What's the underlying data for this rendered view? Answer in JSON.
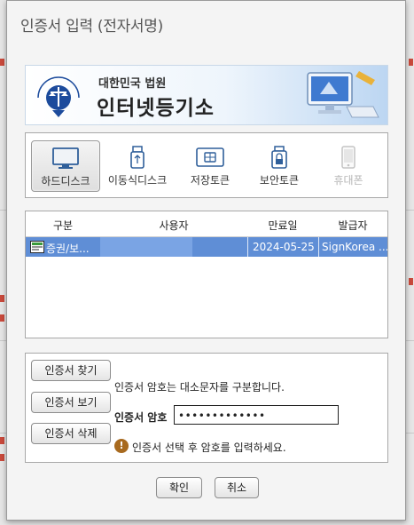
{
  "dialog": {
    "title": "인증서 입력 (전자서명)"
  },
  "banner": {
    "subtitle": "대한민국 법원",
    "main": "인터넷등기소"
  },
  "devices": [
    {
      "label": "하드디스크",
      "icon": "monitor-icon",
      "state": "selected"
    },
    {
      "label": "이동식디스크",
      "icon": "usb-icon",
      "state": "normal"
    },
    {
      "label": "저장토큰",
      "icon": "smartcard-icon",
      "state": "normal"
    },
    {
      "label": "보안토큰",
      "icon": "lock-token-icon",
      "state": "normal"
    },
    {
      "label": "휴대폰",
      "icon": "phone-icon",
      "state": "disabled"
    }
  ],
  "cert_table": {
    "headers": [
      "구분",
      "사용자",
      "만료일",
      "발급자"
    ],
    "rows": [
      {
        "type": "증권/보...",
        "user": "",
        "expiry": "2024-05-25",
        "issuer": "SignKorea ..."
      }
    ]
  },
  "actions": {
    "find": "인증서 찾기",
    "view": "인증서 보기",
    "delete": "인증서 삭제"
  },
  "password": {
    "note": "인증서 암호는 대소문자를 구분합니다.",
    "label": "인증서 암호",
    "value": "•••••••••••••",
    "warning": "인증서 선택 후 암호를 입력하세요."
  },
  "footer": {
    "ok": "확인",
    "cancel": "취소"
  },
  "colors": {
    "selected_row": "#5f8ed6",
    "warning": "#a86a1f"
  }
}
